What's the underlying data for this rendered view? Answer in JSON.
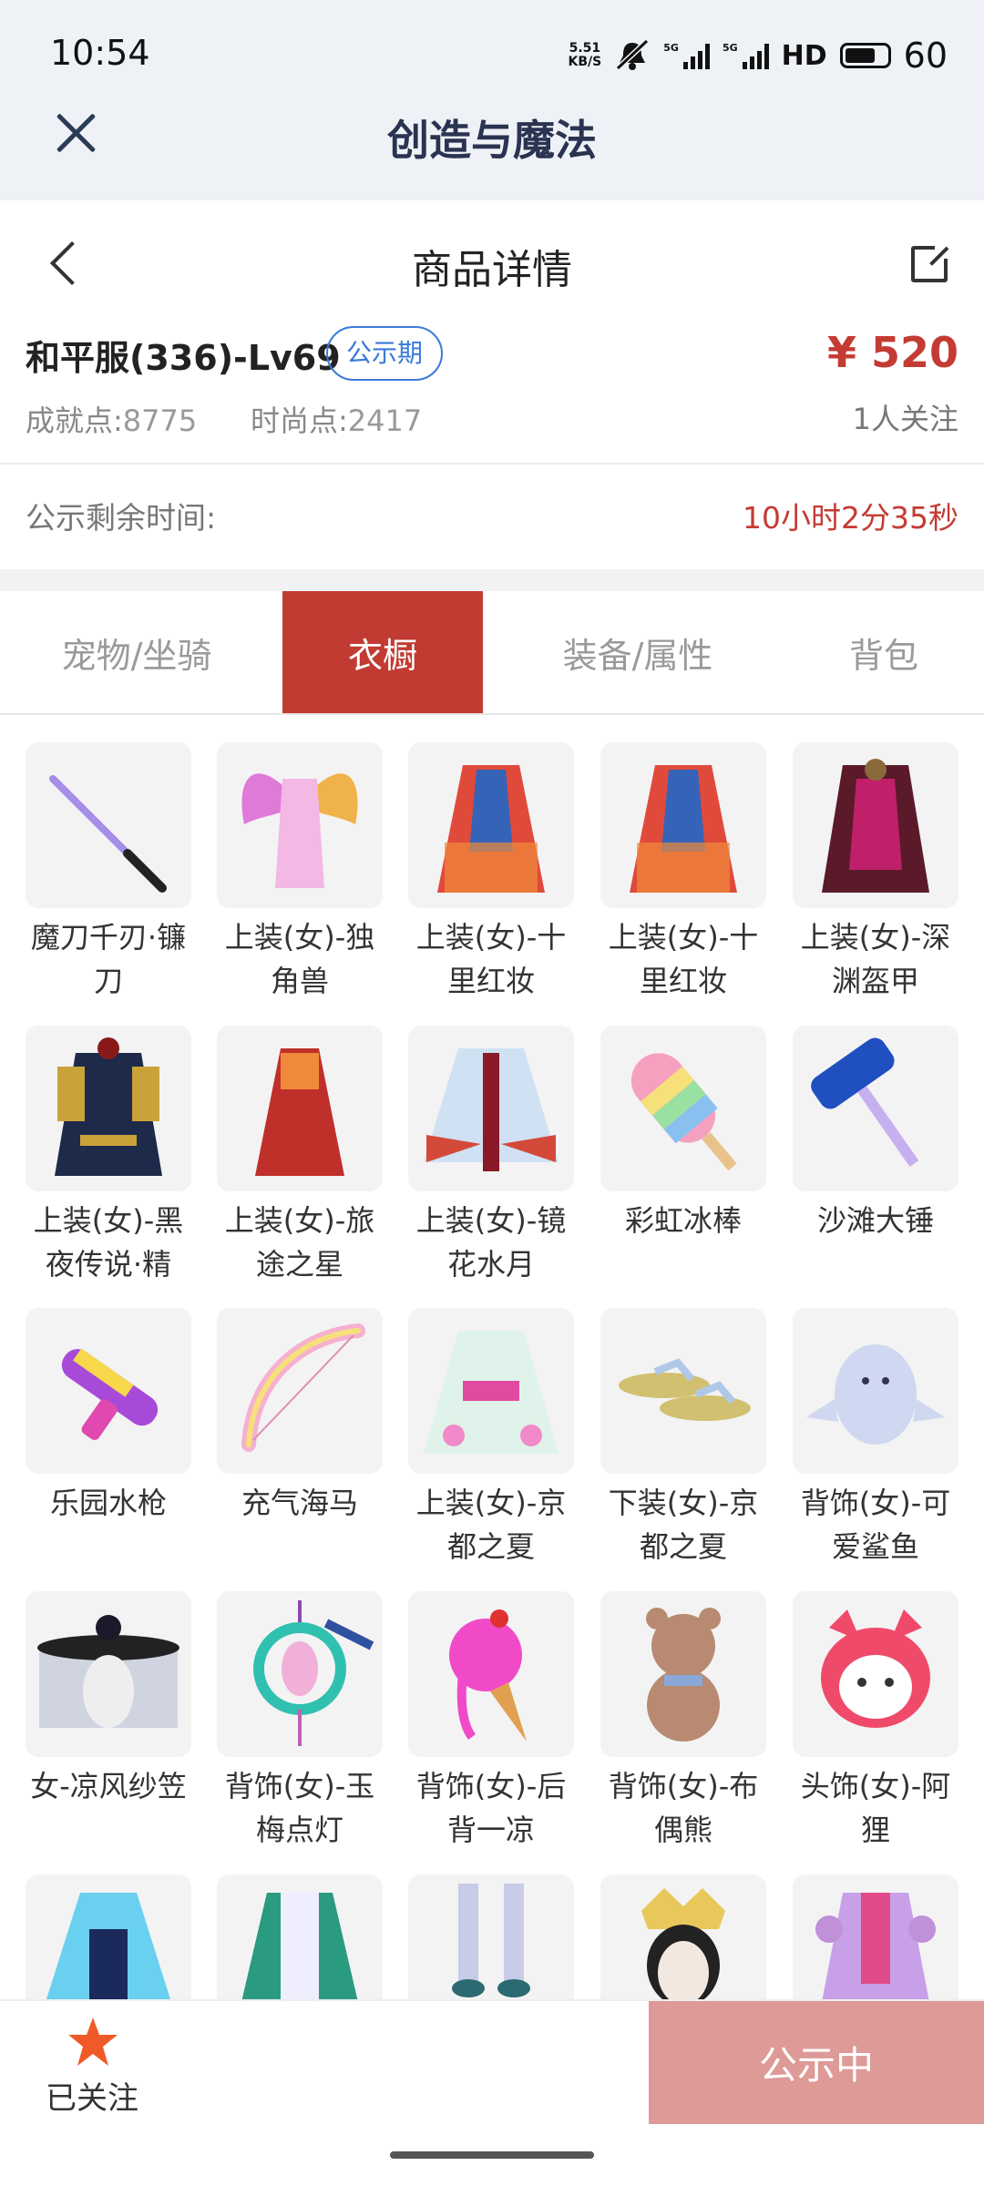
{
  "status_bar": {
    "time": "10:54",
    "net_speed_value": "5.51",
    "net_speed_unit": "KB/S",
    "signal1_label": "5G",
    "signal2_label": "5G",
    "hd_label": "HD",
    "battery_level": "60"
  },
  "app": {
    "title": "创造与魔法"
  },
  "page": {
    "title": "商品详情"
  },
  "product": {
    "name": "和平服(336)-Lv69",
    "badge": "公示期",
    "price": "¥ 520",
    "achievement_label": "成就点:",
    "achievement_value": "8775",
    "fashion_label": "时尚点:",
    "fashion_value": "2417",
    "followers": "1人关注",
    "remain_label": "公示剩余时间:",
    "remain_time": "10小时2分35秒"
  },
  "tabs": [
    {
      "label": "宠物/坐骑",
      "active": false
    },
    {
      "label": "衣橱",
      "active": true
    },
    {
      "label": "装备/属性",
      "active": false
    },
    {
      "label": "背包",
      "active": false
    }
  ],
  "items": [
    {
      "label": "魔刀千刃·镰刀",
      "icon": "katana-icon"
    },
    {
      "label": "上装(女)-独角兽",
      "icon": "wings-dress-icon"
    },
    {
      "label": "上装(女)-十里红妆",
      "icon": "red-robe-icon"
    },
    {
      "label": "上装(女)-十里红妆",
      "icon": "red-robe-icon"
    },
    {
      "label": "上装(女)-深渊盔甲",
      "icon": "armor-icon"
    },
    {
      "label": "上装(女)-黑夜传说·精",
      "icon": "dark-outfit-icon"
    },
    {
      "label": "上装(女)-旅途之星",
      "icon": "red-dress-icon"
    },
    {
      "label": "上装(女)-镜花水月",
      "icon": "white-robe-icon"
    },
    {
      "label": "彩虹冰棒",
      "icon": "rainbow-popsicle-icon"
    },
    {
      "label": "沙滩大锤",
      "icon": "hammer-icon"
    },
    {
      "label": "乐园水枪",
      "icon": "water-gun-icon"
    },
    {
      "label": "充气海马",
      "icon": "inflatable-bow-icon"
    },
    {
      "label": "上装(女)-京都之夏",
      "icon": "kimono-icon"
    },
    {
      "label": "下装(女)-京都之夏",
      "icon": "sandals-icon"
    },
    {
      "label": "背饰(女)-可爱鲨鱼",
      "icon": "shark-icon"
    },
    {
      "label": "女-凉风纱笠",
      "icon": "veil-hat-icon"
    },
    {
      "label": "背饰(女)-玉梅点灯",
      "icon": "lantern-icon"
    },
    {
      "label": "背饰(女)-后背一凉",
      "icon": "ice-cream-icon"
    },
    {
      "label": "背饰(女)-布偶熊",
      "icon": "teddy-bear-icon"
    },
    {
      "label": "头饰(女)-阿狸",
      "icon": "fox-head-icon"
    },
    {
      "label": "",
      "icon": "blue-dress-icon"
    },
    {
      "label": "",
      "icon": "green-outfit-icon"
    },
    {
      "label": "",
      "icon": "white-legs-icon"
    },
    {
      "label": "",
      "icon": "crown-head-icon"
    },
    {
      "label": "",
      "icon": "purple-outfit-icon"
    }
  ],
  "bottom": {
    "follow_label": "已关注",
    "cta_label": "公示中"
  },
  "colors": {
    "accent_red": "#c23b32",
    "price_red": "#c43b33",
    "badge_blue": "#3a7ad9",
    "cta_disabled": "#dd9a96"
  }
}
